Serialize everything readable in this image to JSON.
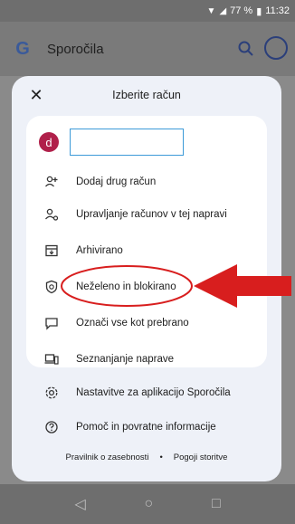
{
  "status_bar": {
    "battery": "77 %",
    "time": "11:32"
  },
  "app_bar": {
    "logo": "G",
    "title": "Sporočila"
  },
  "modal": {
    "title": "Izberite račun",
    "account_initial": "d",
    "items": [
      {
        "label": "Dodaj drug račun",
        "icon": "add-account-icon"
      },
      {
        "label": "Upravljanje računov v tej napravi",
        "icon": "manage-accounts-icon"
      },
      {
        "label": "Arhivirano",
        "icon": "archive-icon"
      },
      {
        "label": "Neželeno in blokirano",
        "icon": "shield-icon"
      },
      {
        "label": "Označi vse kot prebrano",
        "icon": "mark-read-icon"
      },
      {
        "label": "Seznanjanje naprave",
        "icon": "devices-icon"
      }
    ],
    "outer_items": [
      {
        "label": "Nastavitve za aplikacijo Sporočila",
        "icon": "gear-icon"
      },
      {
        "label": "Pomoč in povratne informacije",
        "icon": "help-icon"
      }
    ],
    "footer": {
      "privacy": "Pravilnik o zasebnosti",
      "separator": "•",
      "terms": "Pogoji storitve"
    }
  },
  "colors": {
    "avatar": "#b0204a",
    "highlight": "#d81e1e",
    "input_border": "#3c9ad8"
  }
}
